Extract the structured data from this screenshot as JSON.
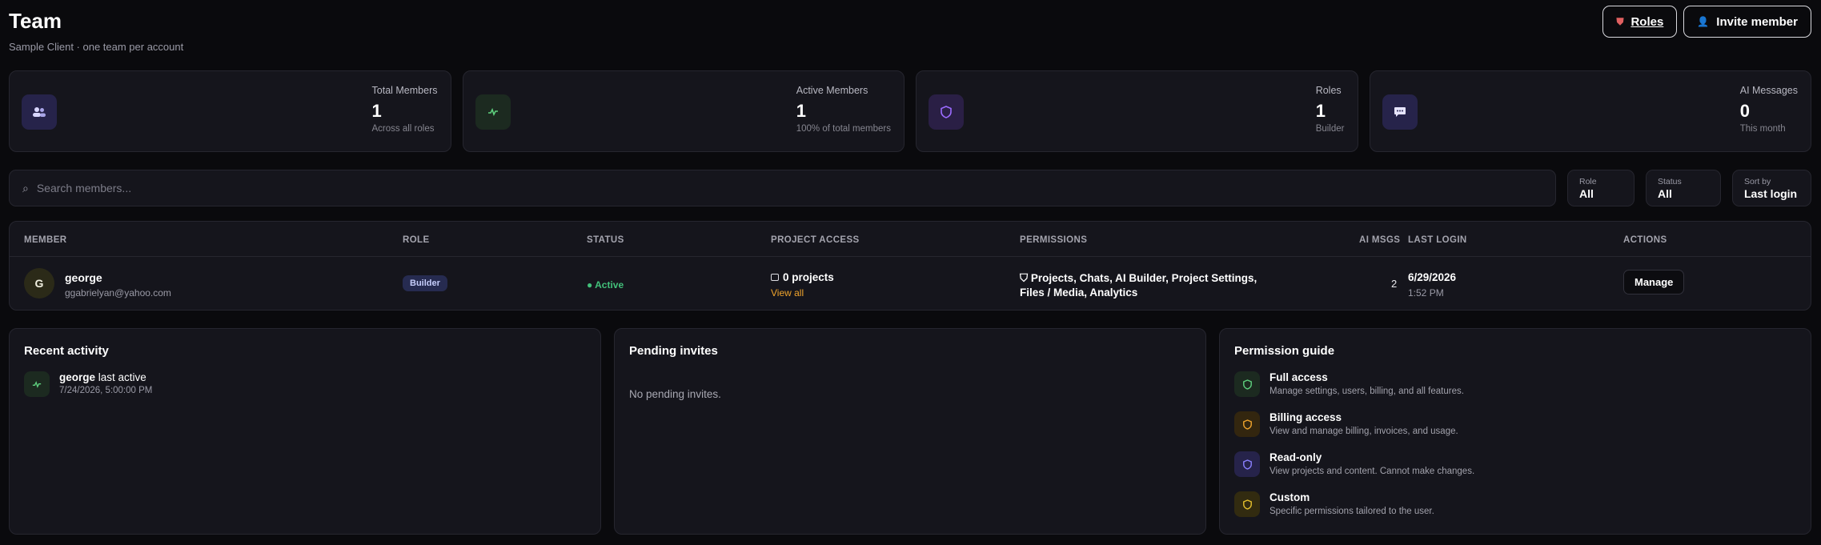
{
  "header": {
    "title": "Team",
    "subtitle": "Sample Client · one team per account",
    "roles_button": "Roles",
    "invite_button": "Invite member"
  },
  "stats": [
    {
      "label": "Total Members",
      "value": "1",
      "sub": "Across all roles",
      "icon": "users-icon",
      "color": "#8b80ff"
    },
    {
      "label": "Active Members",
      "value": "1",
      "sub": "100% of total members",
      "icon": "activity-icon",
      "color": "#5ed07e"
    },
    {
      "label": "Roles",
      "value": "1",
      "sub": "Builder",
      "icon": "shield-icon",
      "color": "#9b6bff"
    },
    {
      "label": "AI Messages",
      "value": "0",
      "sub": "This month",
      "icon": "chat-icon",
      "color": "#8b80ff"
    }
  ],
  "search": {
    "placeholder": "Search members..."
  },
  "filters": [
    {
      "label": "Role",
      "value": "All"
    },
    {
      "label": "Status",
      "value": "All"
    },
    {
      "label": "Sort by",
      "value": "Last login"
    }
  ],
  "table": {
    "headers": [
      "MEMBER",
      "ROLE",
      "STATUS",
      "PROJECT ACCESS",
      "PERMISSIONS",
      "AI MSGS",
      "LAST LOGIN",
      "ACTIONS"
    ],
    "rows": [
      {
        "initial": "G",
        "name": "george",
        "email": "ggabrielyan@yahoo.com",
        "role": "Builder",
        "status": "● Active",
        "projects": "0 projects",
        "projects_link": "View all",
        "permissions": "Projects, Chats, AI Builder, Project Settings, Files / Media, Analytics",
        "ai_msgs": "2",
        "last_login_date": "6/29/2026",
        "last_login_time": "1:52 PM",
        "action": "Manage"
      }
    ]
  },
  "recent_activity": {
    "title": "Recent activity",
    "items": [
      {
        "user": "george",
        "text": "last active",
        "date": "7/24/2026, 5:00:00 PM"
      }
    ]
  },
  "pending_invites": {
    "title": "Pending invites",
    "empty": "No pending invites."
  },
  "permission_guide": {
    "title": "Permission guide",
    "items": [
      {
        "name": "Full access",
        "desc": "Manage settings, users, billing, and all features.",
        "color": "#5ed07e"
      },
      {
        "name": "Billing access",
        "desc": "View and manage billing, invoices, and usage.",
        "color": "#f0a42c"
      },
      {
        "name": "Read-only",
        "desc": "View projects and content. Cannot make changes.",
        "color": "#8b80ff"
      },
      {
        "name": "Custom",
        "desc": "Specific permissions tailored to the user.",
        "color": "#e5c02d"
      }
    ]
  }
}
